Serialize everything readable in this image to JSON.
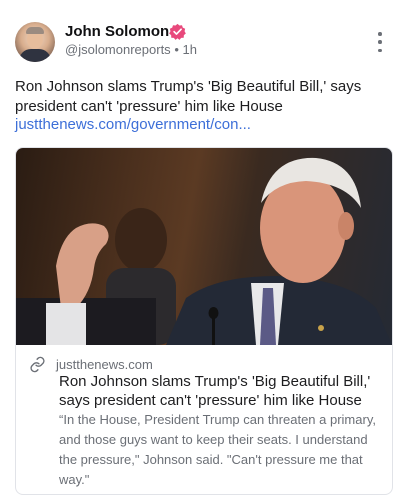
{
  "author": {
    "name": "John Solomon",
    "handle": "@jsolomonreports",
    "time_separator": "•",
    "time": "1h",
    "verified": true
  },
  "post": {
    "text": "Ron Johnson slams Trump's 'Big Beautiful Bill,' says president can't 'pressure' him like House",
    "link": "justthenews.com/government/con..."
  },
  "link_card": {
    "domain": "justthenews.com",
    "title": "Ron Johnson slams Trump's 'Big Beautiful Bill,' says president can't 'pressure' him like House",
    "description": "“In the House, President Trump can threaten a primary, and those guys want to keep their seats. I understand the pressure,\" Johnson said. \"Can't pressure me that way.\""
  },
  "icons": {
    "verified": "verified-badge-icon",
    "more": "more-vertical-icon",
    "link": "link-icon"
  },
  "colors": {
    "link": "#3d6fd8",
    "verified_badge": "#e8497c",
    "secondary_text": "#6b6f76",
    "card_border": "#e1e3e8"
  }
}
